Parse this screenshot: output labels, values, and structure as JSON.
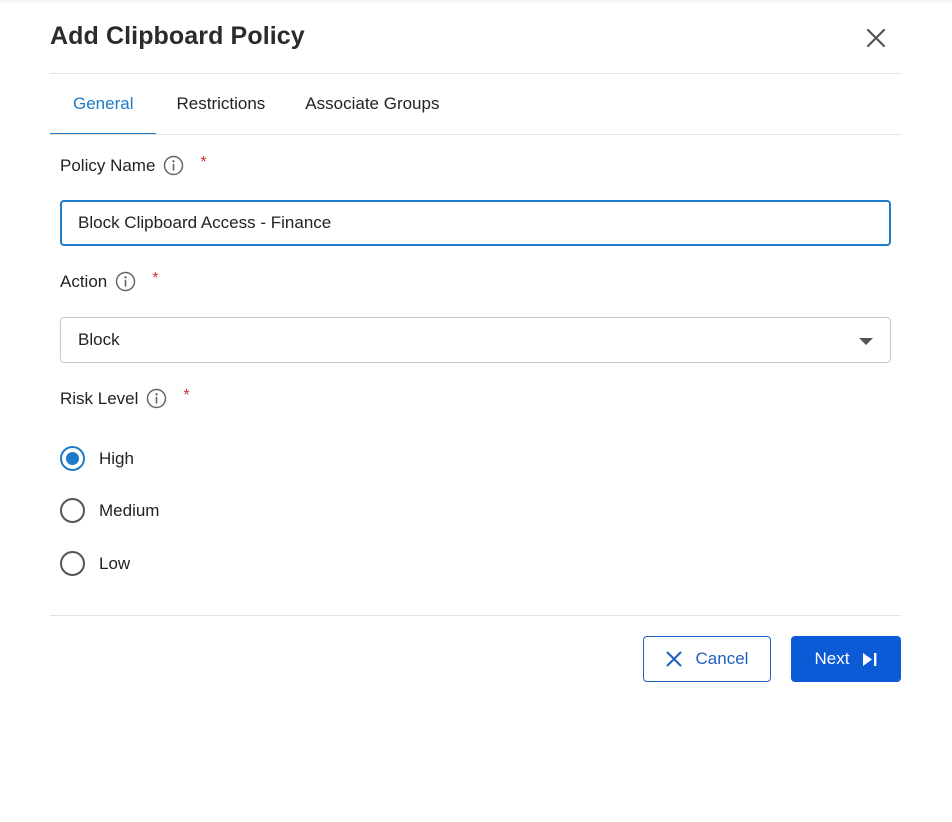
{
  "dialog": {
    "title": "Add Clipboard Policy"
  },
  "tabs": [
    {
      "label": "General"
    },
    {
      "label": "Restrictions"
    },
    {
      "label": "Associate Groups"
    }
  ],
  "form": {
    "policy_name": {
      "label": "Policy Name",
      "value": "Block Clipboard Access - Finance",
      "required_mark": "*"
    },
    "action": {
      "label": "Action",
      "selected": "Block",
      "required_mark": "*"
    },
    "risk_level": {
      "label": "Risk Level",
      "required_mark": "*",
      "options": [
        {
          "label": "High",
          "checked": true
        },
        {
          "label": "Medium",
          "checked": false
        },
        {
          "label": "Low",
          "checked": false
        }
      ]
    }
  },
  "footer": {
    "cancel_label": "Cancel",
    "next_label": "Next"
  },
  "icons": {
    "close": "close-icon",
    "info": "info-icon",
    "caret": "caret-down-icon",
    "cancel": "x-icon",
    "next": "skip-next-icon"
  },
  "colors": {
    "accent": "#1f7ac8",
    "primary_button": "#0b5ad6",
    "required": "#d32f2f"
  }
}
